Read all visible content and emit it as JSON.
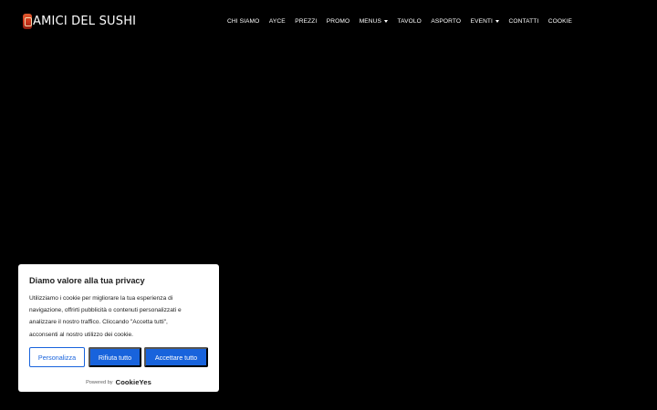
{
  "header": {
    "logo_text": "AMICI DEL SUSHI",
    "nav": [
      {
        "label": "CHI SIAMO",
        "dropdown": false
      },
      {
        "label": "AYCE",
        "dropdown": false
      },
      {
        "label": "PREZZI",
        "dropdown": false
      },
      {
        "label": "PROMO",
        "dropdown": false
      },
      {
        "label": "MENUS",
        "dropdown": true
      },
      {
        "label": "TAVOLO",
        "dropdown": false
      },
      {
        "label": "ASPORTO",
        "dropdown": false
      },
      {
        "label": "EVENTI",
        "dropdown": true
      },
      {
        "label": "CONTATTI",
        "dropdown": false
      },
      {
        "label": "COOKIE",
        "dropdown": false
      }
    ]
  },
  "consent": {
    "title": "Diamo valore alla tua privacy",
    "body_lines": [
      "Utilizziamo i cookie per migliorare la tua esperienza di",
      "navigazione, offrirti pubblicità o contenuti personalizzati e",
      "analizzare il nostro traffico. Cliccando \"Accetta tutti\",",
      "acconsenti al nostro utilizzo dei cookie."
    ],
    "customize_label": "Personalizza",
    "reject_label": "Rifiuta tutto",
    "accept_label": "Accettare tutto",
    "powered_by_label": "Powered by",
    "brand_name": "CookieYes"
  },
  "colors": {
    "background": "#000000",
    "accent": "#1863dc"
  }
}
